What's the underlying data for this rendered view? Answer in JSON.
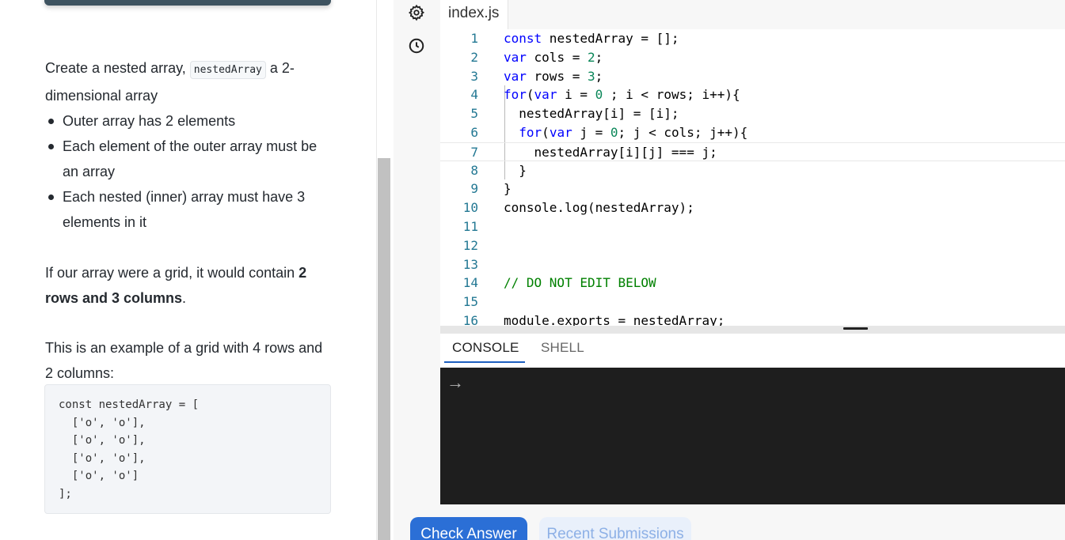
{
  "instructions": {
    "intro_before": "Create a nested array, ",
    "intro_code": "nestedArray",
    "intro_after": " a 2-dimensional array",
    "bullets": [
      "Outer array has 2 elements",
      "Each element of the outer array must be an array",
      "Each nested (inner) array must have 3 elements in it"
    ],
    "grid_before": "If our array were a grid, it would contain ",
    "grid_bold": "2 rows and 3 columns",
    "grid_after": ".",
    "example_intro": "This is an example of a grid with 4 rows and 2 columns:",
    "example_code": "const nestedArray = [\n  ['o', 'o'],\n  ['o', 'o'],\n  ['o', 'o'],\n  ['o', 'o']\n];"
  },
  "editor": {
    "file_tab": "index.js",
    "rail_icons": [
      "settings-icon",
      "history-icon"
    ],
    "line_numbers": [
      "1",
      "2",
      "3",
      "4",
      "5",
      "6",
      "7",
      "8",
      "9",
      "10",
      "11",
      "12",
      "13",
      "14",
      "15",
      "16"
    ],
    "code_line_16": "module.exports = nestedArray;"
  },
  "console": {
    "tabs": [
      "CONSOLE",
      "SHELL"
    ],
    "active_tab": "CONSOLE",
    "prompt": "→"
  },
  "actions": {
    "check_answer": "Check Answer",
    "recent_submissions": "Recent Submissions"
  },
  "colors": {
    "accent": "#2b6fd6",
    "top_bar": "#3e5360",
    "console_bg": "#1e1e1e"
  }
}
